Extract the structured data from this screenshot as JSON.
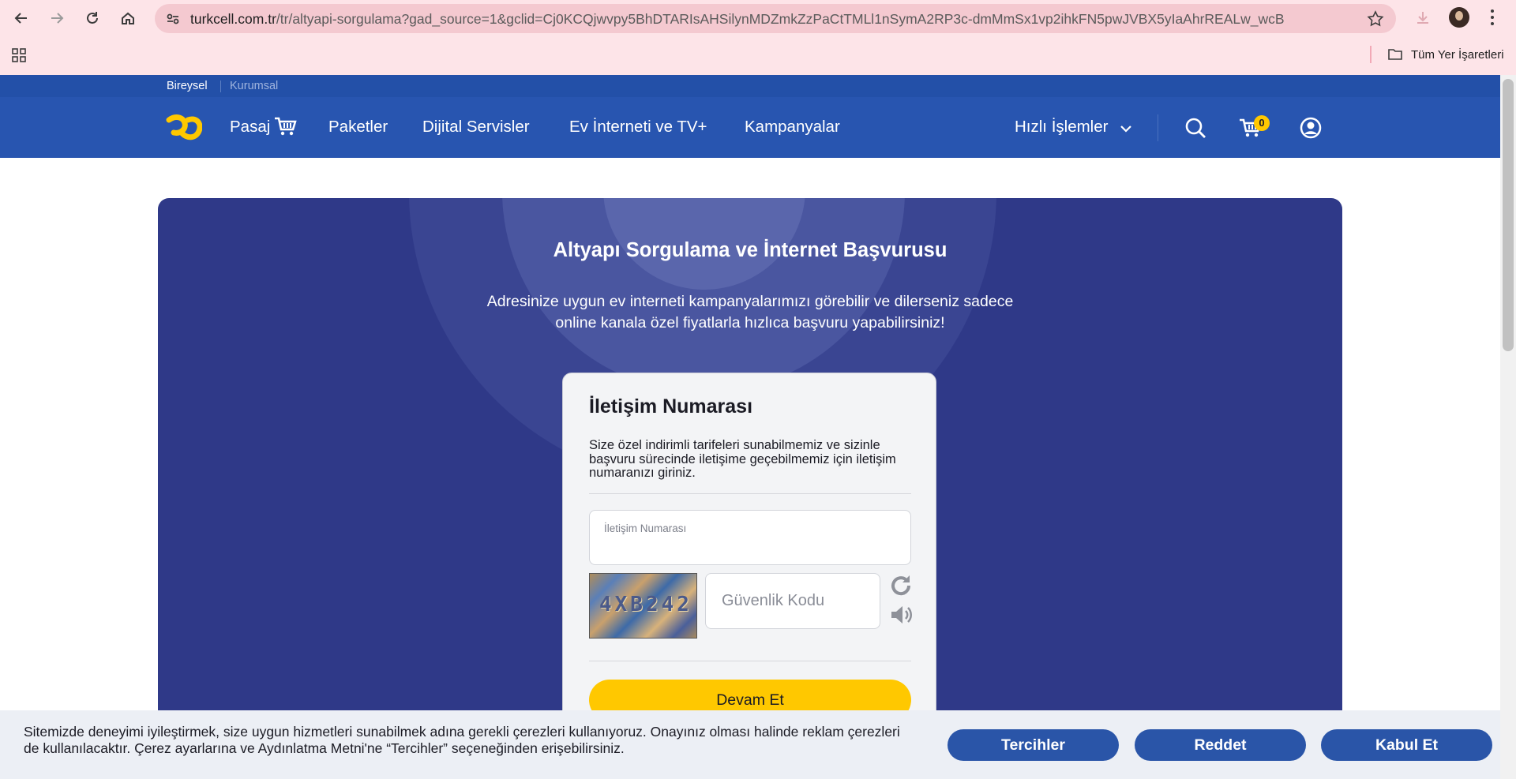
{
  "browser": {
    "url_domain": "turkcell.com.tr",
    "url_path": "/tr/altyapi-sorgulama?gad_source=1&gclid=Cj0KCQjwvpy5BhDTARIsAHSilynMDZmkZzPaCtTMLl1nSymA2RP3c-dmMmSx1vp2ihkFN5pwJVBX5yIaAhrREALw_wcB",
    "bookmarks_label": "Tüm Yer İşaretleri"
  },
  "site": {
    "top_tabs": {
      "personal": "Bireysel",
      "corporate": "Kurumsal"
    },
    "nav": {
      "pasaj": "Pasaj",
      "packages": "Paketler",
      "digital": "Dijital Servisler",
      "home_internet": "Ev İnterneti ve TV+",
      "campaigns": "Kampanyalar",
      "quick": "Hızlı İşlemler"
    },
    "cart_count": "0"
  },
  "hero": {
    "title": "Altyapı Sorgulama ve İnternet Başvurusu",
    "subtitle_line1": "Adresinize uygun ev interneti kampanyalarımızı görebilir ve dilerseniz sadece",
    "subtitle_line2": "online kanala özel fiyatlarla hızlıca başvuru yapabilirsiniz!"
  },
  "form": {
    "title": "İletişim Numarası",
    "description": "Size özel indirimli tarifeleri sunabilmemiz ve sizinle başvuru sürecinde iletişime geçebilmemiz için iletişim numaranızı giriniz.",
    "phone_label": "İletişim Numarası",
    "captcha_text": "4XB242",
    "captcha_placeholder": "Güvenlik Kodu",
    "submit": "Devam Et"
  },
  "cookie": {
    "text": "Sitemizde deneyimi iyileştirmek, size uygun hizmetleri sunabilmek adına gerekli çerezleri kullanıyoruz. Onayınız olması halinde reklam çerezleri de kullanılacaktır. Çerez ayarlarına ve Aydınlatma Metni'ne “Tercihler” seçeneğinden erişebilirsiniz.",
    "preferences": "Tercihler",
    "reject": "Reddet",
    "accept": "Kabul Et"
  },
  "colors": {
    "brand_blue": "#2855b0",
    "hero_bg": "#2f3988",
    "accent_yellow": "#ffc800"
  }
}
